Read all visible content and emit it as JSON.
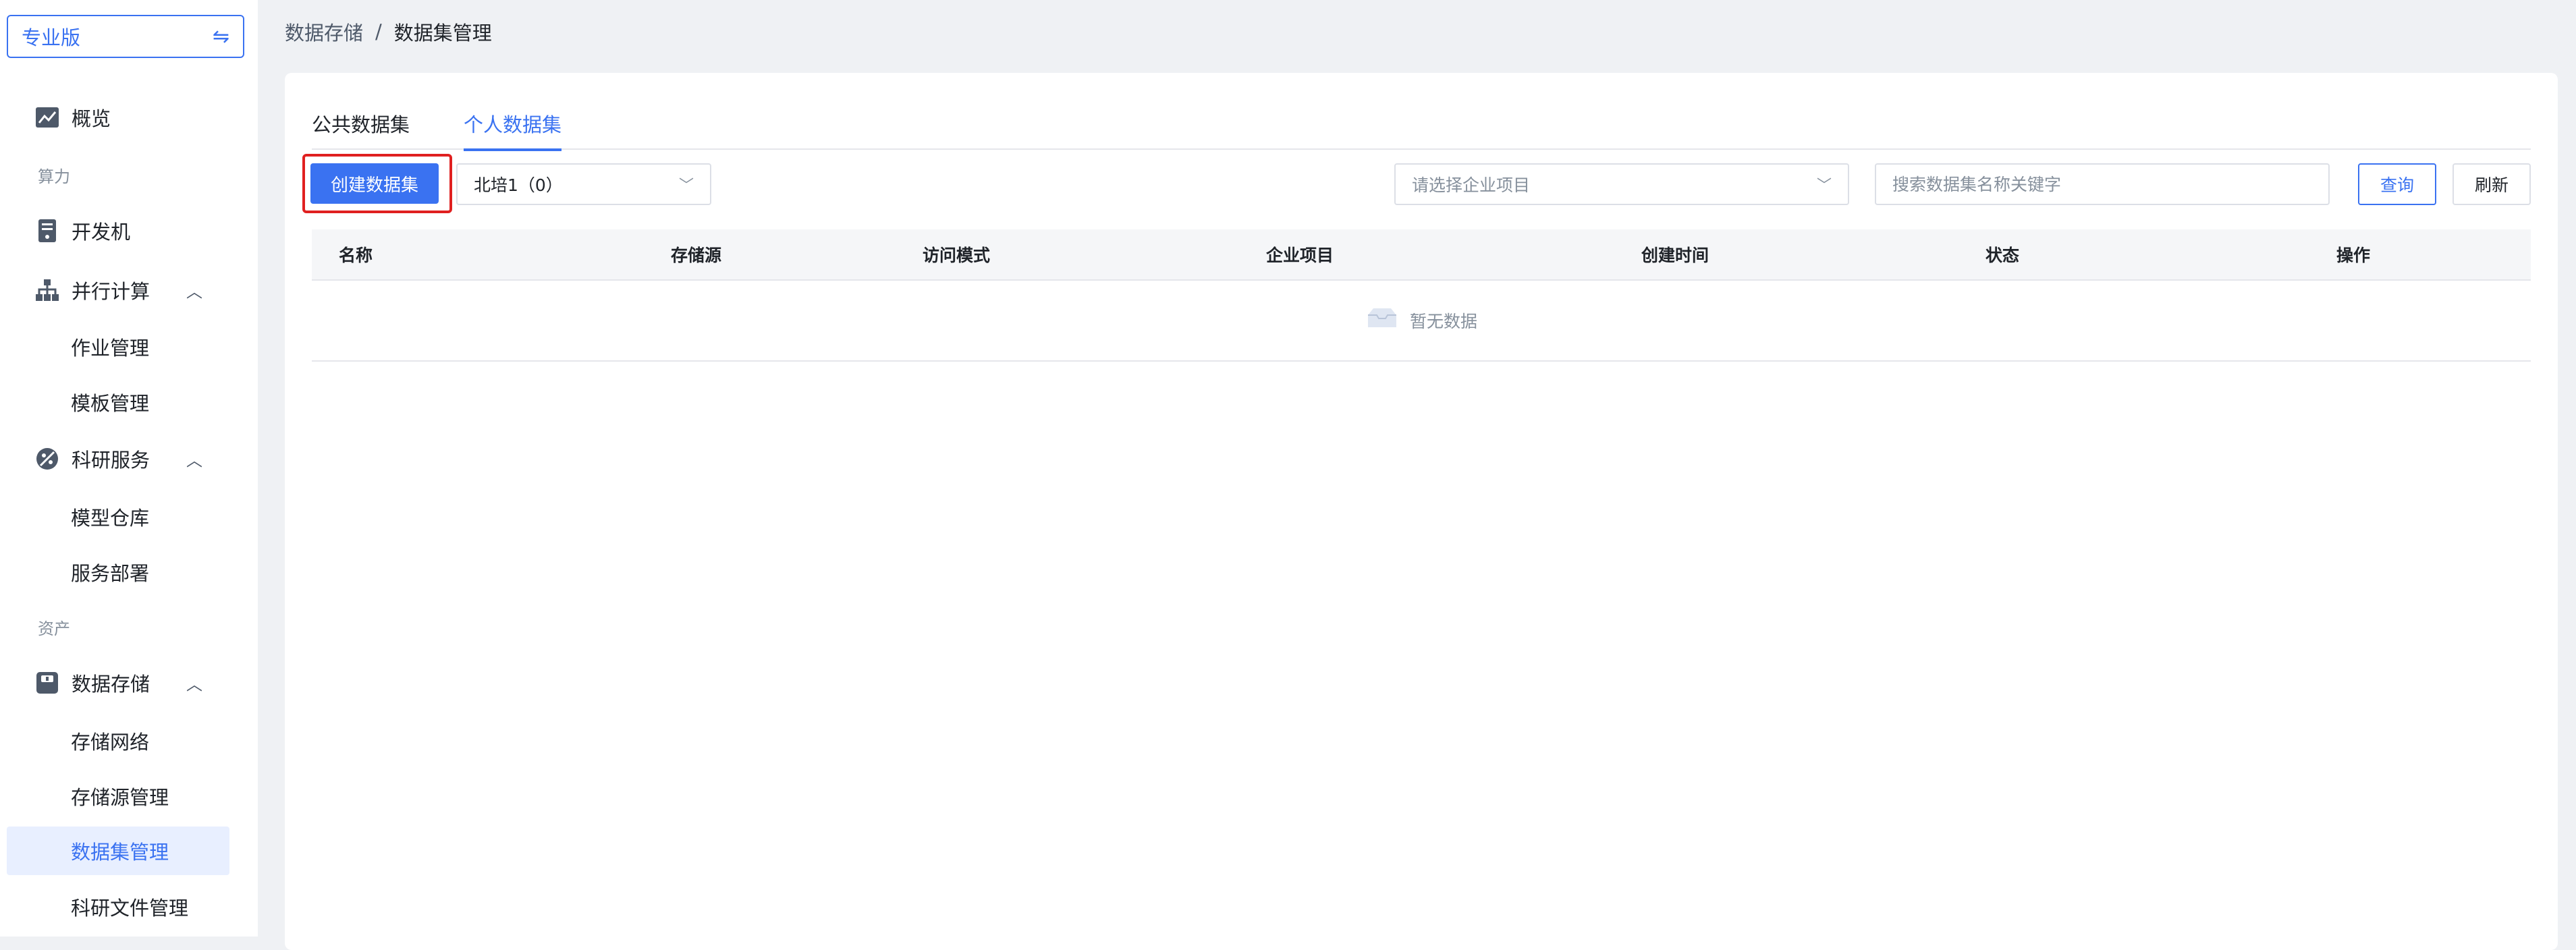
{
  "sidebar": {
    "edition": "专业版",
    "items": [
      {
        "label": "概览",
        "icon": "chart-trend-icon"
      },
      {
        "section": "算力"
      },
      {
        "label": "开发机",
        "icon": "server-icon"
      },
      {
        "label": "并行计算",
        "icon": "hierarchy-icon",
        "expanded": true
      },
      {
        "label": "作业管理"
      },
      {
        "label": "模板管理"
      },
      {
        "label": "科研服务",
        "icon": "research-icon",
        "expanded": true
      },
      {
        "label": "模型仓库"
      },
      {
        "label": "服务部署"
      },
      {
        "section": "资产"
      },
      {
        "label": "数据存储",
        "icon": "storage-icon",
        "expanded": true
      },
      {
        "label": "存储网络"
      },
      {
        "label": "存储源管理"
      },
      {
        "label": "数据集管理",
        "active": true
      },
      {
        "label": "科研文件管理"
      }
    ]
  },
  "breadcrumb": {
    "parent": "数据存储",
    "separator": "/",
    "current": "数据集管理"
  },
  "tabs": [
    {
      "label": "公共数据集",
      "active": false
    },
    {
      "label": "个人数据集",
      "active": true
    }
  ],
  "toolbar": {
    "create_label": "创建数据集",
    "region_select": "北培1（0）",
    "project_placeholder": "请选择企业项目",
    "search_placeholder": "搜索数据集名称关键字",
    "query_label": "查询",
    "refresh_label": "刷新"
  },
  "table": {
    "columns": [
      "名称",
      "存储源",
      "访问模式",
      "企业项目",
      "创建时间",
      "状态",
      "操作"
    ],
    "empty_text": "暂无数据"
  },
  "colors": {
    "accent": "#3a72f1",
    "highlight_border": "#e02020"
  }
}
